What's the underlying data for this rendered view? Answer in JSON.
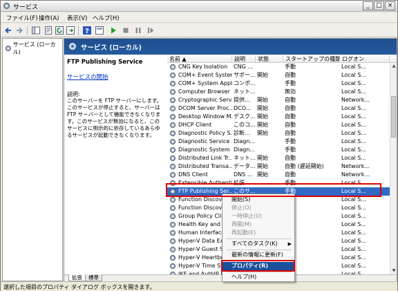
{
  "window": {
    "title": "サービス",
    "controls": [
      "_",
      "□",
      "×"
    ]
  },
  "menu": [
    "ファイル(F)",
    "操作(A)",
    "表示(V)",
    "ヘルプ(H)"
  ],
  "tree": {
    "root": "サービス (ローカル)"
  },
  "banner": {
    "title": "サービス (ローカル)"
  },
  "description": {
    "service_name": "FTP Publishing Service",
    "start_link": "サービスの開始",
    "label": "説明:",
    "text": "このサーバーを FTP サーバーにします。このサービスが停止すると、サーバーは FTP サーバーとして機能できなくなります。このサービスが無効になると、このサービスに明示的に依存しているあらゆるサービスが起動できなくなります。"
  },
  "list": {
    "columns": [
      "名前 ▲",
      "説明",
      "状態",
      "スタートアップの種類",
      "ログオン"
    ],
    "rows": [
      [
        "CNG Key Isolation",
        "CNG ...",
        "",
        "手動",
        "Local S..."
      ],
      [
        "COM+ Event System",
        "サポー...",
        "開始",
        "自動",
        "Local S..."
      ],
      [
        "COM+ System Appl...",
        "コンポ...",
        "",
        "手動",
        "Local S..."
      ],
      [
        "Computer Browser",
        "ネット...",
        "",
        "無効",
        "Local S..."
      ],
      [
        "Cryptographic Serv...",
        "提供...",
        "開始",
        "自動",
        "Network..."
      ],
      [
        "DCOM Server Proc...",
        "DCO...",
        "開始",
        "自動",
        "Local S..."
      ],
      [
        "Desktop Window M...",
        "デスク...",
        "開始",
        "自動",
        "Local S..."
      ],
      [
        "DHCP Client",
        "このコ...",
        "開始",
        "自動",
        "Local S..."
      ],
      [
        "Diagnostic Policy S...",
        "診断...",
        "開始",
        "自動",
        "Local S..."
      ],
      [
        "Diagnostic Service ...",
        "Diagn...",
        "",
        "手動",
        "Local S..."
      ],
      [
        "Diagnostic System ...",
        "Diagn...",
        "",
        "手動",
        "Local S..."
      ],
      [
        "Distributed Link Tr...",
        "ネット...",
        "開始",
        "自動",
        "Local S..."
      ],
      [
        "Distributed Transa...",
        "データ...",
        "開始",
        "自動 (遅延開始)",
        "Network..."
      ],
      [
        "DNS Client",
        "DNS ...",
        "開始",
        "自動",
        "Network..."
      ],
      [
        "Extensible Authenti...",
        "拡張...",
        "",
        "手動",
        "Local S..."
      ],
      [
        "FTP Publishing Ser...",
        "このサ...",
        "",
        "手動",
        "Local S..."
      ],
      [
        "Function Discover",
        "",
        "",
        "",
        "Local S..."
      ],
      [
        "Function Discover",
        "",
        "",
        "",
        "Local S..."
      ],
      [
        "Group Policy Client",
        "",
        "",
        "",
        "Local S..."
      ],
      [
        "Health Key and Ce",
        "",
        "",
        "",
        "Local S..."
      ],
      [
        "Human Interface D",
        "",
        "",
        "",
        "Local S..."
      ],
      [
        "Hyper-V Data Exc",
        "",
        "",
        "",
        "Local S..."
      ],
      [
        "Hyper-V Guest Sh",
        "",
        "",
        "",
        "Local S..."
      ],
      [
        "Hyper-V Heartbea",
        "",
        "",
        "",
        "Local S..."
      ],
      [
        "Hyper-V Time Sy",
        "",
        "",
        "",
        "Local S..."
      ],
      [
        "IKE and AuthIP IP",
        "",
        "",
        "",
        "Local S..."
      ]
    ],
    "selected_index": 15
  },
  "context_menu": {
    "items": [
      {
        "label": "開始(S)",
        "disabled": false
      },
      {
        "label": "停止(O)",
        "disabled": true
      },
      {
        "label": "一時停止(U)",
        "disabled": true
      },
      {
        "label": "再開(M)",
        "disabled": true
      },
      {
        "label": "再起動(E)",
        "disabled": true
      },
      {
        "label": "すべてのタスク(K)",
        "disabled": false,
        "submenu": true
      },
      {
        "label": "最新の情報に更新(F)",
        "disabled": false
      },
      {
        "label": "プロパティ(R)",
        "disabled": false,
        "highlighted": true
      },
      {
        "label": "ヘルプ(H)",
        "disabled": false
      }
    ]
  },
  "tabs": [
    "拡張",
    "標準"
  ],
  "status_bar": "選択した項目のプロパティ ダイアログ ボックスを開きます。",
  "colors": {
    "banner": "#245a9e",
    "selection": "#3169c6",
    "highlight_box": "#e00000"
  }
}
